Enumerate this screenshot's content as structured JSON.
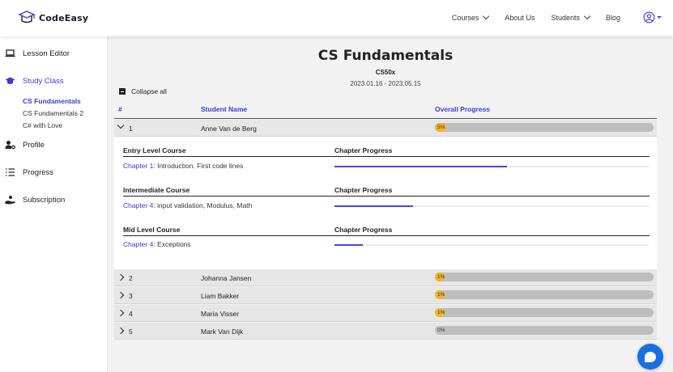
{
  "brand": {
    "name": "CodeEasy",
    "color": "#3b3bd6"
  },
  "nav": {
    "items": [
      {
        "label": "Courses",
        "dropdown": true
      },
      {
        "label": "About Us",
        "dropdown": false
      },
      {
        "label": "Students",
        "dropdown": true
      },
      {
        "label": "Blog",
        "dropdown": false
      }
    ],
    "user_icon": "user-circle-icon"
  },
  "sidebar": {
    "items": [
      {
        "label": "Lesson Editor",
        "icon": "laptop-icon"
      },
      {
        "label": "Study Class",
        "icon": "graduation-cap-icon",
        "active": true
      },
      {
        "label": "Profile",
        "icon": "user-cog-icon"
      },
      {
        "label": "Progress",
        "icon": "list-icon"
      },
      {
        "label": "Subscription",
        "icon": "hand-coin-icon"
      }
    ],
    "subitems": [
      {
        "label": "CS Fundamentals",
        "active": true
      },
      {
        "label": "CS Fundamentals 2"
      },
      {
        "label": "C# with Love"
      }
    ]
  },
  "main": {
    "title": "CS Fundamentals",
    "code": "CS50x",
    "dates": "2023.01.16 - 2023.05.15",
    "collapse_label": "Collapse all",
    "columns": {
      "num": "#",
      "name": "Student Name",
      "progress": "Overall Progress"
    },
    "students": [
      {
        "num": "1",
        "name": "Anne Van de Berg",
        "progress_label": "5%",
        "progress": 0.05,
        "expanded": true
      },
      {
        "num": "2",
        "name": "Johanna Jansen",
        "progress_label": "1%",
        "progress": 0.01
      },
      {
        "num": "3",
        "name": "Liam Bakker",
        "progress_label": "1%",
        "progress": 0.01
      },
      {
        "num": "4",
        "name": "Maria Visser",
        "progress_label": "1%",
        "progress": 0.01
      },
      {
        "num": "5",
        "name": "Mark Van Dijk",
        "progress_label": "0%",
        "progress": 0.0
      }
    ],
    "detail": {
      "chapter_progress_label": "Chapter Progress",
      "sections": [
        {
          "course": "Entry Level Course",
          "chapter": "Chapter 1:",
          "lesson": "Introduction. First code lines",
          "progress": 0.55
        },
        {
          "course": "Intermediate Course",
          "chapter": "Chapter 4:",
          "lesson": "input validation, Modulus, Math",
          "progress": 0.25
        },
        {
          "course": "Mid Level Course",
          "chapter": "Chapter 4:",
          "lesson": "Exceptions",
          "progress": 0.09
        }
      ]
    }
  },
  "chat": {
    "icon": "chat-icon",
    "color": "#1a6fe0"
  }
}
